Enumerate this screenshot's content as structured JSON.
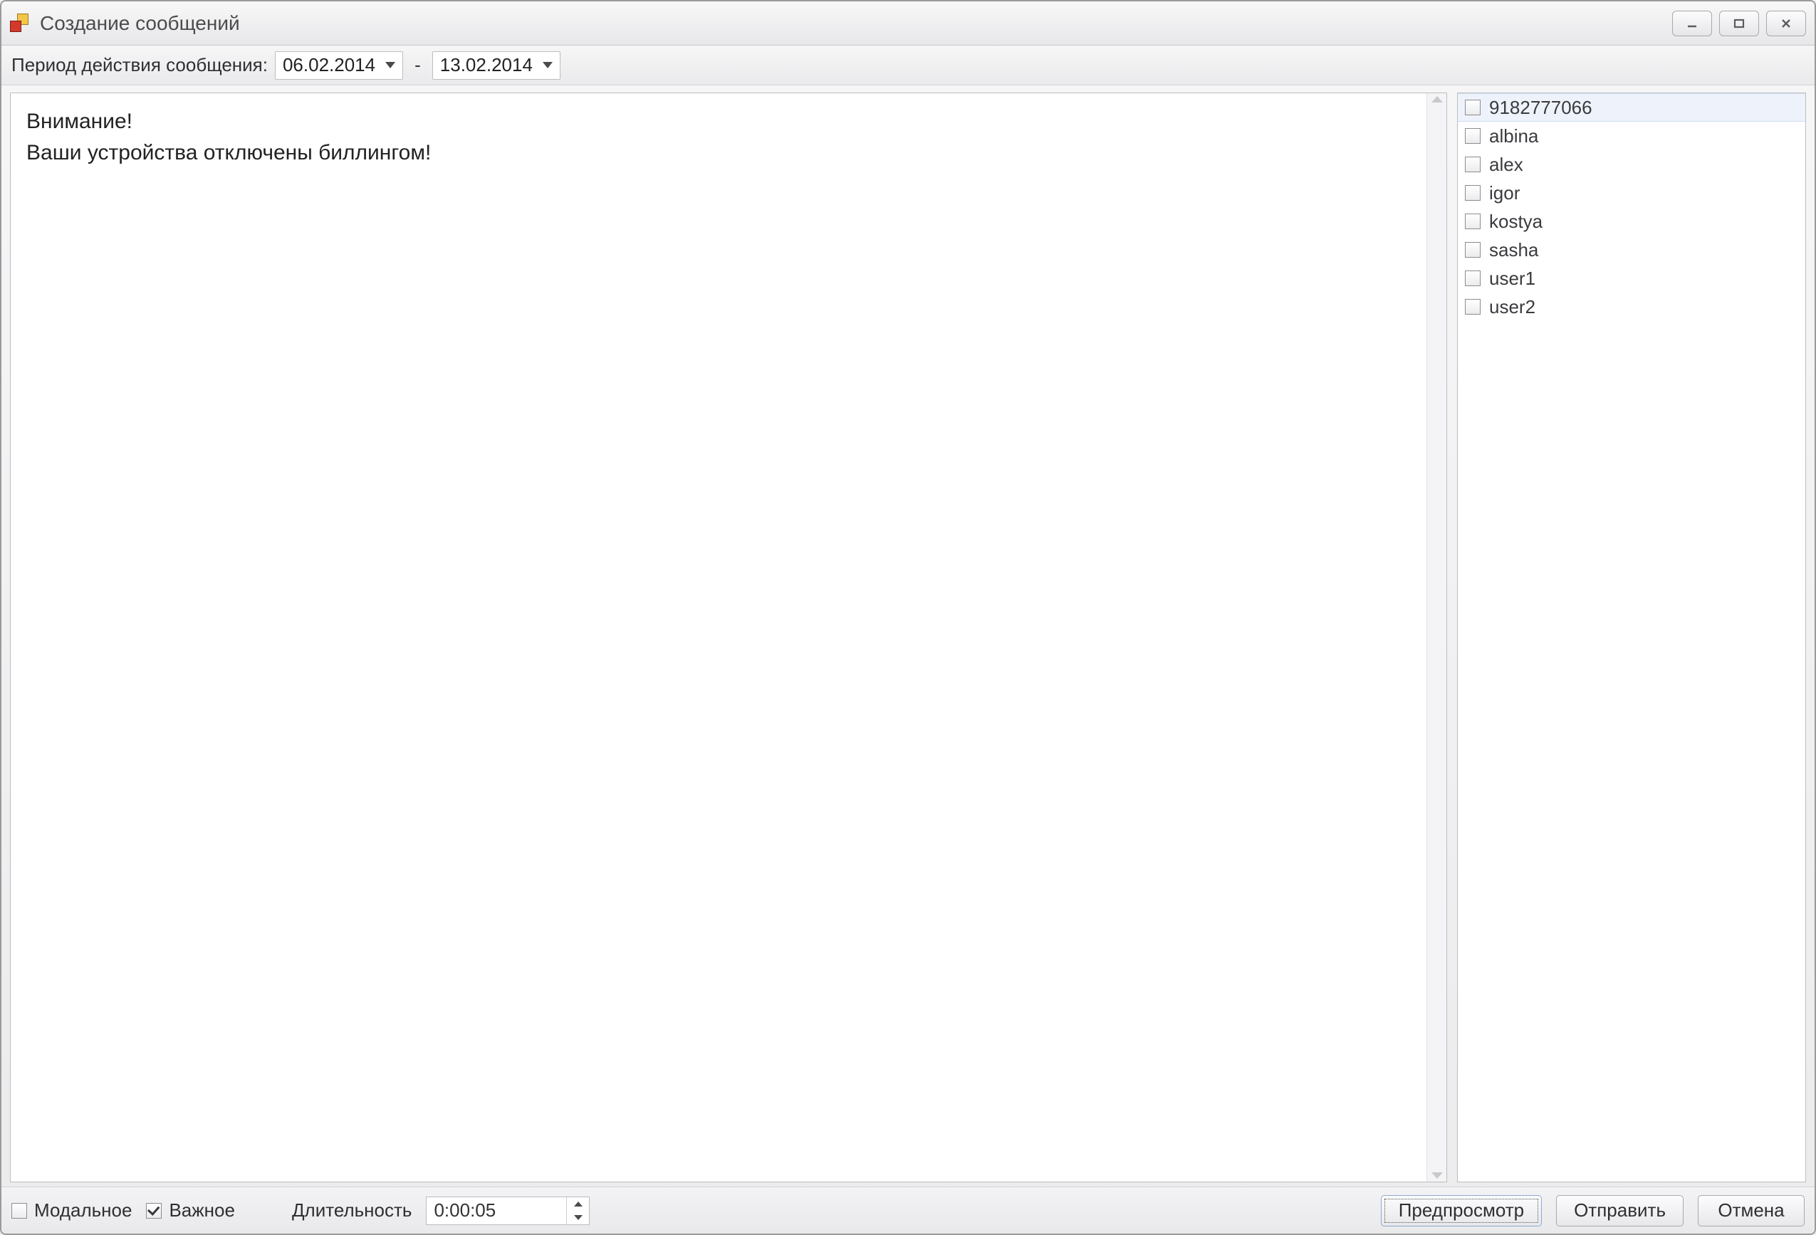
{
  "window": {
    "title": "Создание сообщений"
  },
  "period": {
    "label": "Период действия сообщения:",
    "from": "06.02.2014",
    "separator": "-",
    "to": "13.02.2014"
  },
  "message": {
    "body": "Внимание!\nВаши устройства отключены биллингом!"
  },
  "recipients": [
    {
      "name": "9182777066",
      "checked": false,
      "selected": true
    },
    {
      "name": "albina",
      "checked": false,
      "selected": false
    },
    {
      "name": "alex",
      "checked": false,
      "selected": false
    },
    {
      "name": "igor",
      "checked": false,
      "selected": false
    },
    {
      "name": "kostya",
      "checked": false,
      "selected": false
    },
    {
      "name": "sasha",
      "checked": false,
      "selected": false
    },
    {
      "name": "user1",
      "checked": false,
      "selected": false
    },
    {
      "name": "user2",
      "checked": false,
      "selected": false
    }
  ],
  "options": {
    "modal": {
      "label": "Модальное",
      "checked": false
    },
    "important": {
      "label": "Важное",
      "checked": true
    },
    "duration_label": "Длительность",
    "duration_value": "0:00:05"
  },
  "buttons": {
    "preview": "Предпросмотр",
    "send": "Отправить",
    "cancel": "Отмена"
  }
}
